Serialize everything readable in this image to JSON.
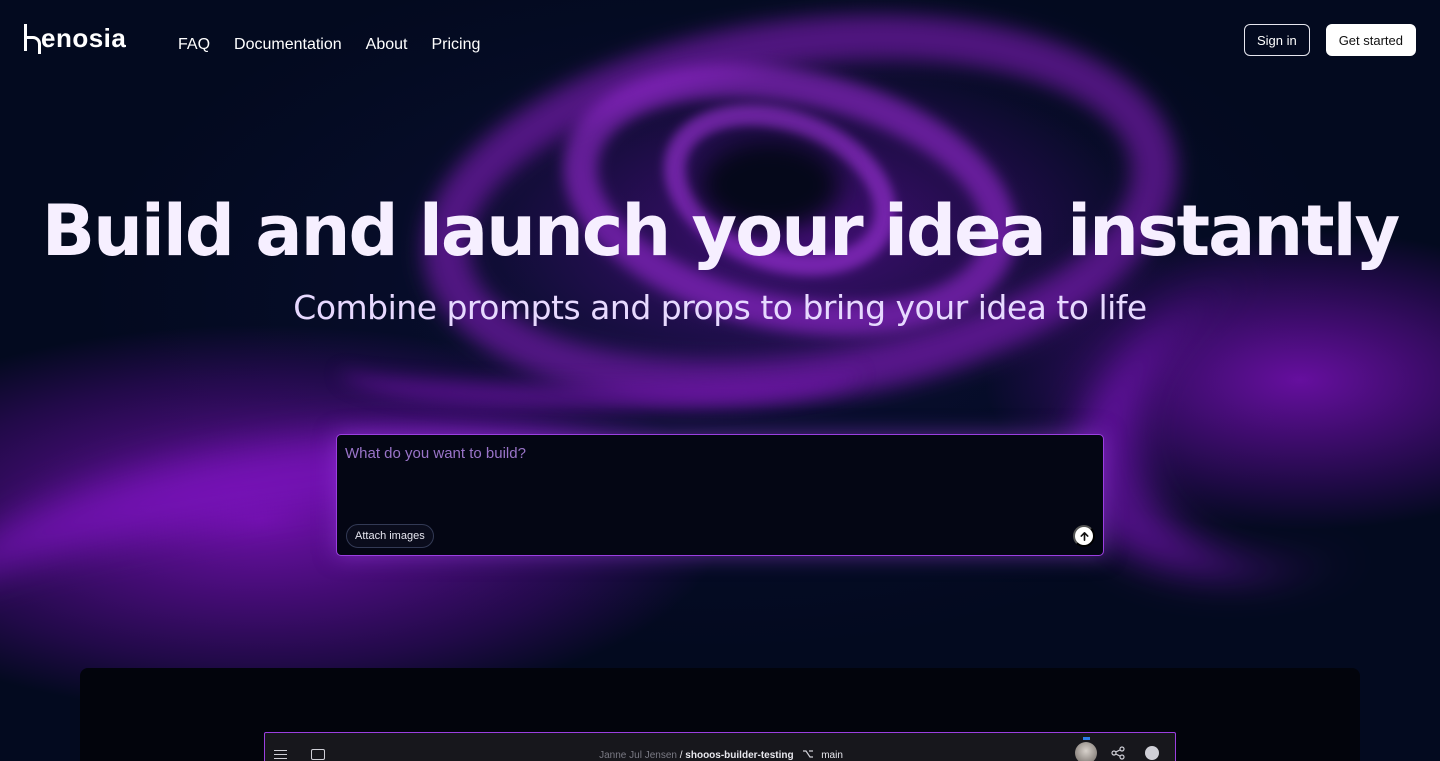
{
  "brand": {
    "name": "enosia"
  },
  "nav": [
    {
      "label": "FAQ"
    },
    {
      "label": "Documentation"
    },
    {
      "label": "About"
    },
    {
      "label": "Pricing"
    }
  ],
  "auth": {
    "sign_in": "Sign in",
    "get_started": "Get started"
  },
  "hero": {
    "title": "Build and launch your idea instantly",
    "subtitle": "Combine prompts and props to bring your idea to life"
  },
  "prompt": {
    "placeholder": "What do you want to build?",
    "attach_label": "Attach images",
    "send_icon": "arrow-up-icon"
  },
  "preview": {
    "user": "Janne Jul Jensen",
    "separator": "/",
    "repo": "shooos-builder-testing",
    "branch": "main",
    "icons": [
      "menu-icon",
      "sidebar-icon",
      "branch-icon",
      "avatar",
      "share-icon",
      "github-icon"
    ]
  },
  "colors": {
    "accent": "#9b3fe0",
    "background": "#030a1f",
    "title": "#f6efff"
  }
}
